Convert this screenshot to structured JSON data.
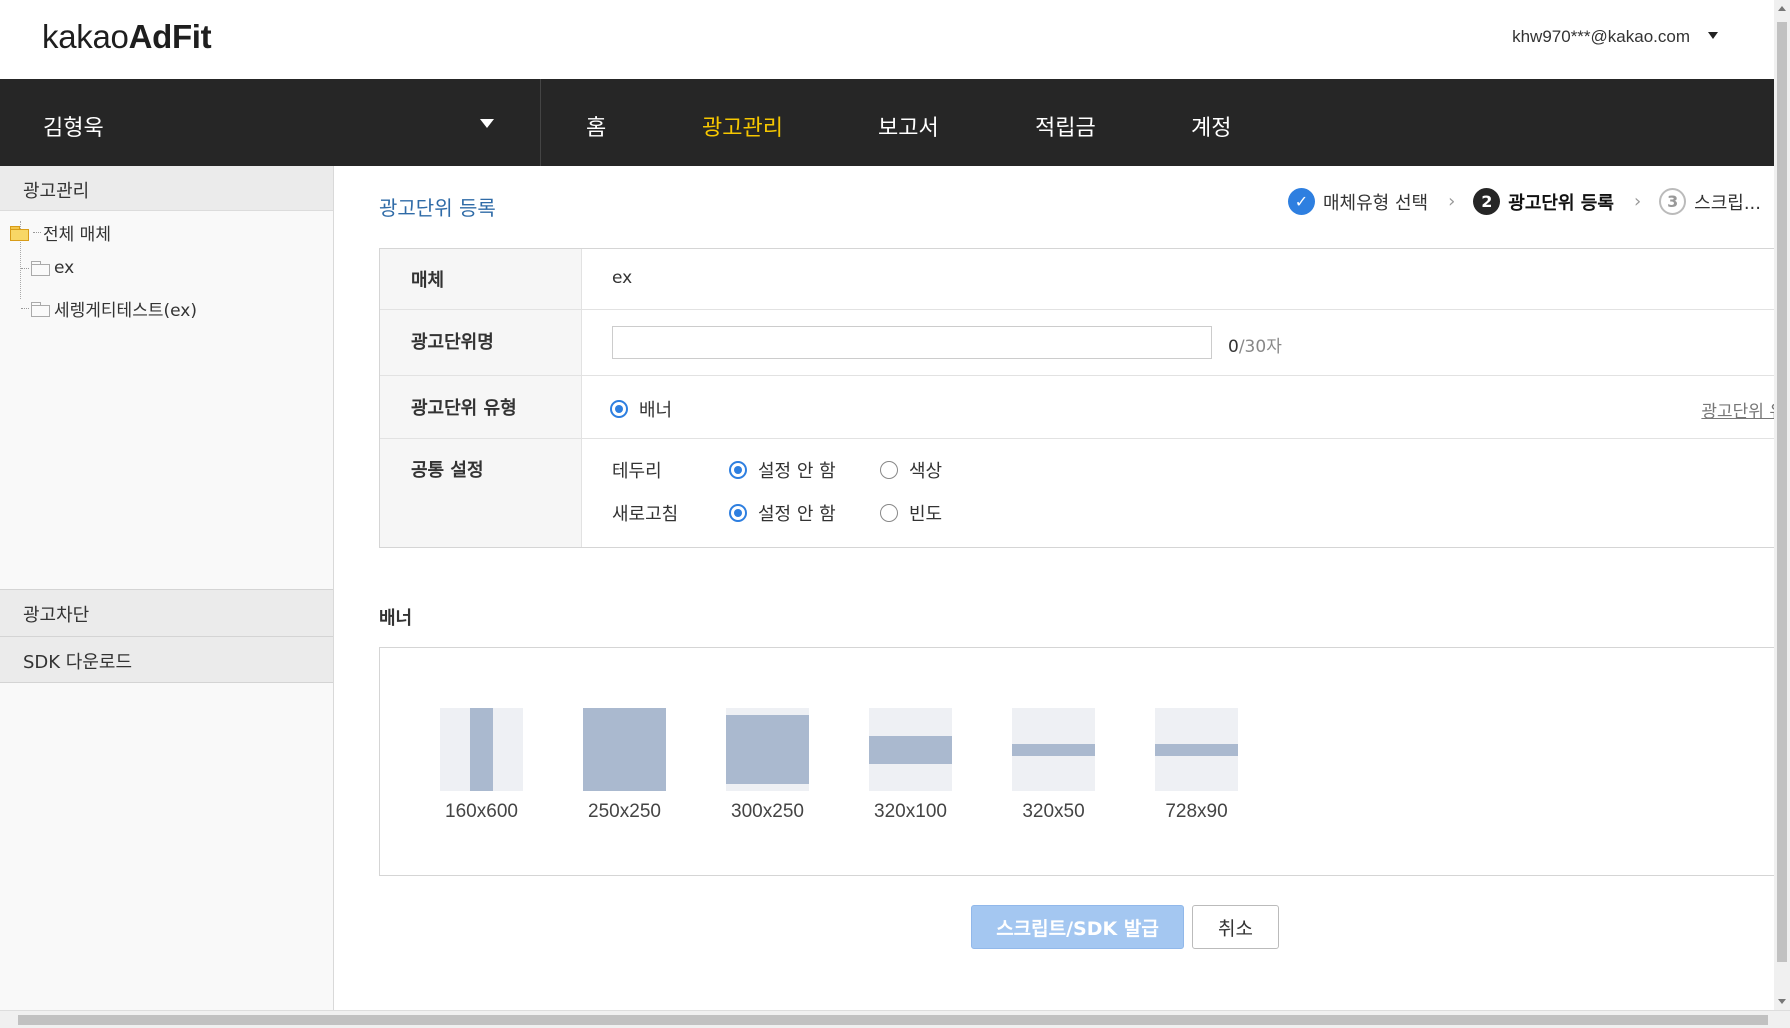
{
  "header": {
    "logo_regular": "kakao",
    "logo_bold": "AdFit",
    "account_email": "khw970***@kakao.com"
  },
  "nav": {
    "user_name": "김형욱",
    "items": [
      {
        "label": "홈",
        "active": false
      },
      {
        "label": "광고관리",
        "active": true
      },
      {
        "label": "보고서",
        "active": false
      },
      {
        "label": "적립금",
        "active": false
      },
      {
        "label": "계정",
        "active": false
      }
    ],
    "active_color": "#f6c700"
  },
  "sidebar": {
    "title": "광고관리",
    "tree": {
      "root": "전체 매체",
      "children": [
        "ex",
        "세렝게티테스트(ex)"
      ]
    },
    "sections": [
      "광고차단",
      "SDK 다운로드"
    ]
  },
  "main": {
    "title": "광고단위 등록",
    "steps": [
      {
        "number": "✓",
        "label": "매체유형 선택",
        "state": "done"
      },
      {
        "number": "2",
        "label": "광고단위 등록",
        "state": "current"
      },
      {
        "number": "3",
        "label": "스크립...",
        "state": "todo"
      }
    ],
    "form": {
      "media_label": "매체",
      "media_value": "ex",
      "name_label": "광고단위명",
      "name_value": "",
      "name_counter_current": "0",
      "name_counter_max": "/30자",
      "type_label": "광고단위 유형",
      "type_option": "배너",
      "type_help_link": "광고단위 유",
      "common_label": "공통 설정",
      "border_label": "테두리",
      "border_options": [
        "설정 안 함",
        "색상"
      ],
      "border_selected": "설정 안 함",
      "refresh_label": "새로고침",
      "refresh_options": [
        "설정 안 함",
        "빈도"
      ],
      "refresh_selected": "설정 안 함"
    },
    "banner_section_title": "배너",
    "banner_sizes": [
      "160x600",
      "250x250",
      "300x250",
      "320x100",
      "320x50",
      "728x90"
    ],
    "buttons": {
      "issue": "스크립트/SDK 발급",
      "cancel": "취소"
    },
    "accent_color": "#2e7fe0",
    "title_color": "#2f6ba7"
  }
}
